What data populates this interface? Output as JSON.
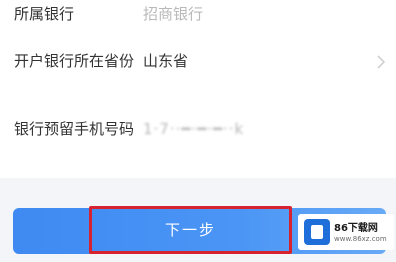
{
  "form": {
    "bank": {
      "label": "所属银行",
      "value": "招商银行"
    },
    "province": {
      "label": "开户银行所在省份",
      "value": "山东省"
    },
    "phone": {
      "label": "银行预留手机号码",
      "value": "1·7··━·━·━··k"
    }
  },
  "next_button": {
    "label": "下一步"
  },
  "watermark": {
    "title": "86下载网",
    "url": "www.86xz.com"
  },
  "colors": {
    "button": "#4a95f5",
    "highlight": "#d6232f",
    "value_muted": "#b9b9b9"
  },
  "icons": {
    "province_arrow": "chevron-right-icon"
  }
}
